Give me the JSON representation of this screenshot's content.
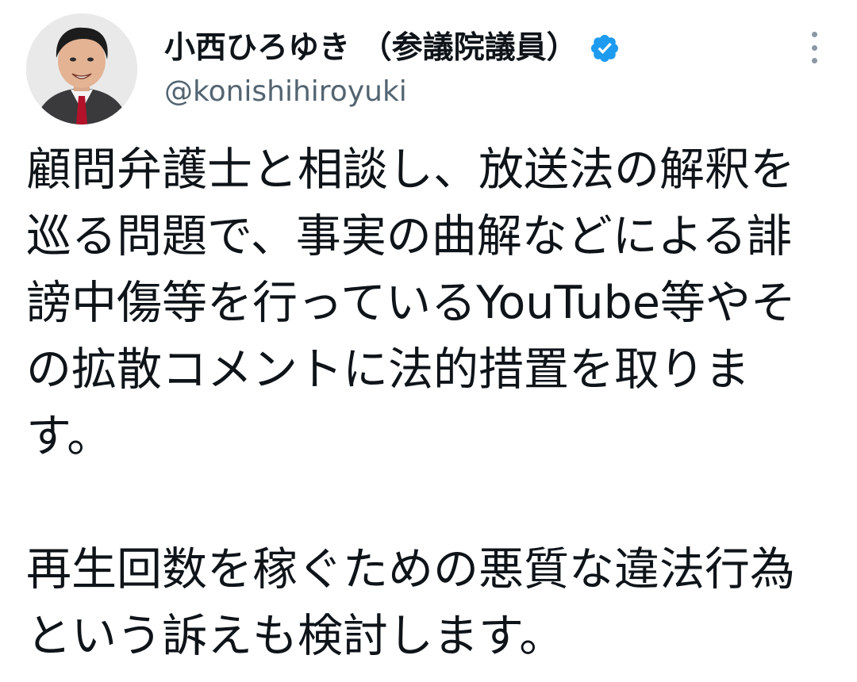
{
  "tweet": {
    "author": {
      "display_name": "小西ひろゆき （参議院議員）",
      "handle": "@konishihiroyuki",
      "verified": true,
      "verified_icon": "verified-badge-icon",
      "avatar_icon": "profile-photo"
    },
    "more_icon": "more-vertical-icon",
    "body": {
      "paragraph_1": "顧問弁護士と相談し、放送法の解釈を巡る問題で、事実の曲解などによる誹謗中傷等を行っているYouTube等やその拡散コメントに法的措置を取ります。",
      "paragraph_2": "再生回数を稼ぐための悪質な違法行為という訴えも検討します。"
    }
  },
  "colors": {
    "text_primary": "#0f1419",
    "text_secondary": "#536471",
    "verified_blue": "#1d9bf0",
    "background": "#ffffff"
  }
}
